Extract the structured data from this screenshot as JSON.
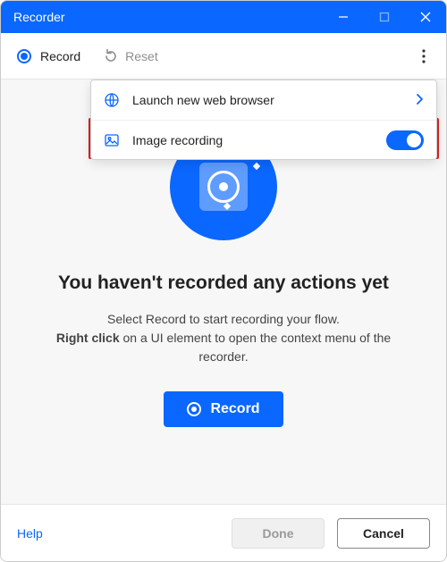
{
  "window": {
    "title": "Recorder"
  },
  "toolbar": {
    "record": "Record",
    "reset": "Reset"
  },
  "menu": {
    "launch": "Launch new web browser",
    "image_recording": "Image recording",
    "image_recording_on": true
  },
  "empty": {
    "headline": "You haven't recorded any actions yet",
    "line1": "Select Record to start recording your flow.",
    "line2a": "Right click",
    "line2b": " on a UI element to open the context menu of the recorder.",
    "record_button": "Record"
  },
  "footer": {
    "help": "Help",
    "done": "Done",
    "cancel": "Cancel"
  },
  "colors": {
    "accent": "#0a67ff",
    "highlight": "#e02020"
  }
}
